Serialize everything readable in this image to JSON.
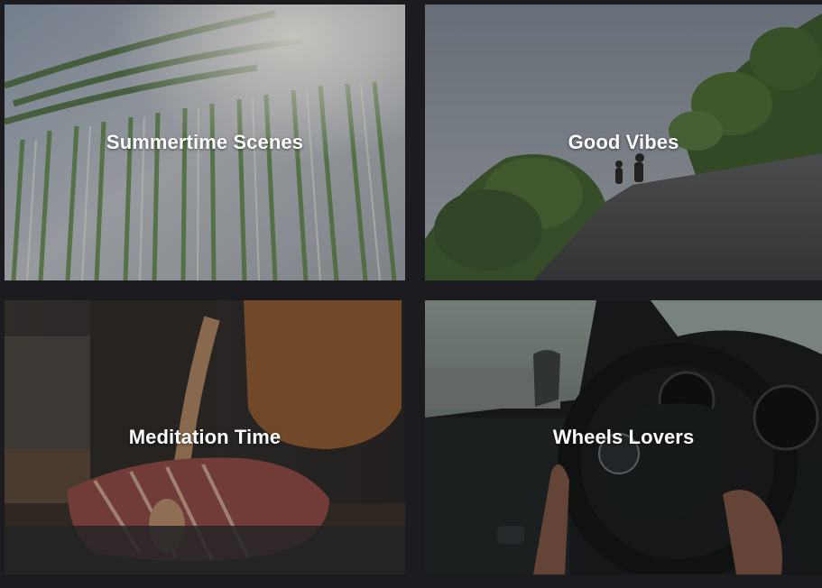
{
  "categories": [
    {
      "title": "Summertime Scenes"
    },
    {
      "title": "Good Vibes"
    },
    {
      "title": "Meditation Time"
    },
    {
      "title": "Wheels Lovers"
    }
  ],
  "colors": {
    "page_background": "#1c1b1f",
    "label_text": "#ffffff"
  }
}
